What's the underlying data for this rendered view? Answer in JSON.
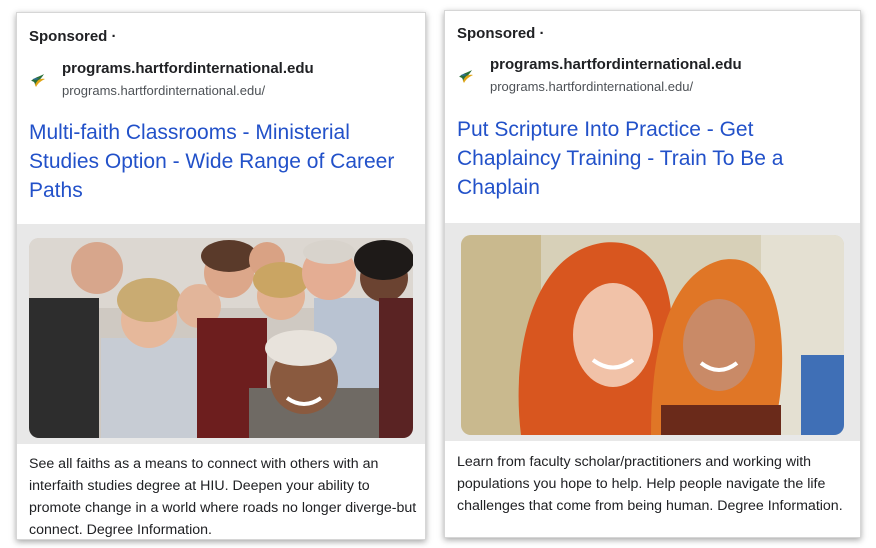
{
  "ads": [
    {
      "sponsored_label": "Sponsored ·",
      "domain": "programs.hartfordinternational.edu",
      "display_url": "programs.hartfordinternational.edu/",
      "headline": "Multi-faith Classrooms - Ministerial Studies Option - Wide Range of Career Paths",
      "image_icon": "group-photo-image",
      "description": "See all faiths as a means to connect with others with an interfaith studies degree at HIU. Deepen your ability to promote change in a world where roads no longer diverge-but connect. Degree Information."
    },
    {
      "sponsored_label": "Sponsored ·",
      "domain": "programs.hartfordinternational.edu",
      "display_url": "programs.hartfordinternational.edu/",
      "headline": "Put Scripture Into Practice - Get Chaplaincy Training - Train To Be a Chaplain",
      "image_icon": "two-women-photo-image",
      "description": "Learn from faculty scholar/practitioners and working with populations you hope to help. Help people navigate the life challenges that come from being human. Degree Information."
    }
  ],
  "colors": {
    "headline_link": "#2251c9",
    "text": "#202124",
    "url": "#4d5156",
    "media_band": "#e8e8e8"
  }
}
